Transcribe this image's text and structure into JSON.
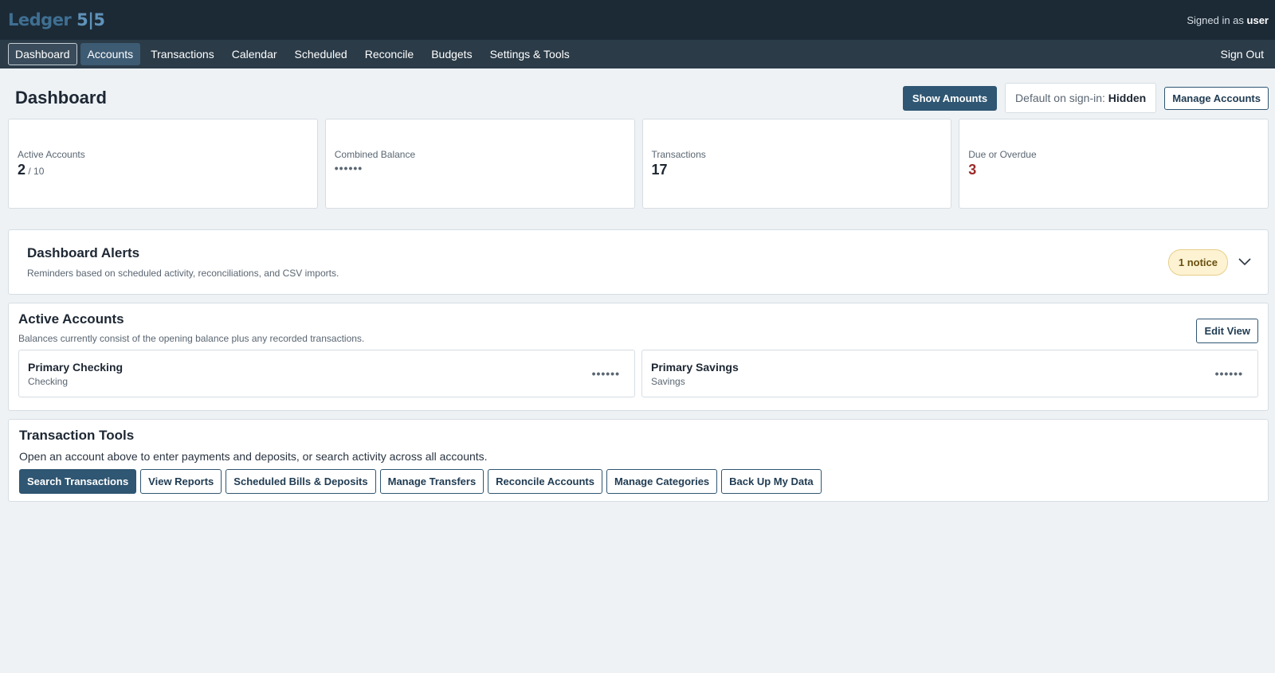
{
  "app": {
    "logo_text": "Ledger ",
    "logo_accent": "5|5",
    "signed_in_prefix": "Signed in as ",
    "signed_in_user": "user"
  },
  "nav": {
    "items": [
      {
        "label": "Dashboard"
      },
      {
        "label": "Accounts"
      },
      {
        "label": "Transactions"
      },
      {
        "label": "Calendar"
      },
      {
        "label": "Scheduled"
      },
      {
        "label": "Reconcile"
      },
      {
        "label": "Budgets"
      },
      {
        "label": "Settings & Tools"
      }
    ],
    "sign_out": "Sign Out"
  },
  "header": {
    "title": "Dashboard",
    "show_amounts": "Show Amounts",
    "default_label": "Default on sign-in: ",
    "default_value": "Hidden",
    "manage_accounts": "Manage Accounts"
  },
  "stats": [
    {
      "label": "Active Accounts",
      "value": "2",
      "sub": " / 10"
    },
    {
      "label": "Combined Balance",
      "value": "••••••"
    },
    {
      "label": "Transactions",
      "value": "17"
    },
    {
      "label": "Due or Overdue",
      "value": "3"
    }
  ],
  "alerts": {
    "title": "Dashboard Alerts",
    "subtitle": "Reminders based on scheduled activity, reconciliations, and CSV imports.",
    "badge": "1 notice"
  },
  "accounts": {
    "title": "Active Accounts",
    "subtitle": "Balances currently consist of the opening balance plus any recorded transactions.",
    "edit_view": "Edit View",
    "items": [
      {
        "name": "Primary Checking",
        "type": "Checking",
        "amount": "••••••"
      },
      {
        "name": "Primary Savings",
        "type": "Savings",
        "amount": "••••••"
      }
    ]
  },
  "tools": {
    "title": "Transaction Tools",
    "subtitle": "Open an account above to enter payments and deposits, or search activity across all accounts.",
    "buttons": [
      {
        "label": "Search Transactions"
      },
      {
        "label": "View Reports"
      },
      {
        "label": "Scheduled Bills & Deposits"
      },
      {
        "label": "Manage Transfers"
      },
      {
        "label": "Reconcile Accounts"
      },
      {
        "label": "Manage Categories"
      },
      {
        "label": "Back Up My Data"
      }
    ]
  },
  "colors": {
    "topbar": "#1c2a36",
    "navbar": "#2b3b48",
    "primary": "#2f5672",
    "danger": "#9c2b2b",
    "badge_bg": "#fdf3d2"
  }
}
